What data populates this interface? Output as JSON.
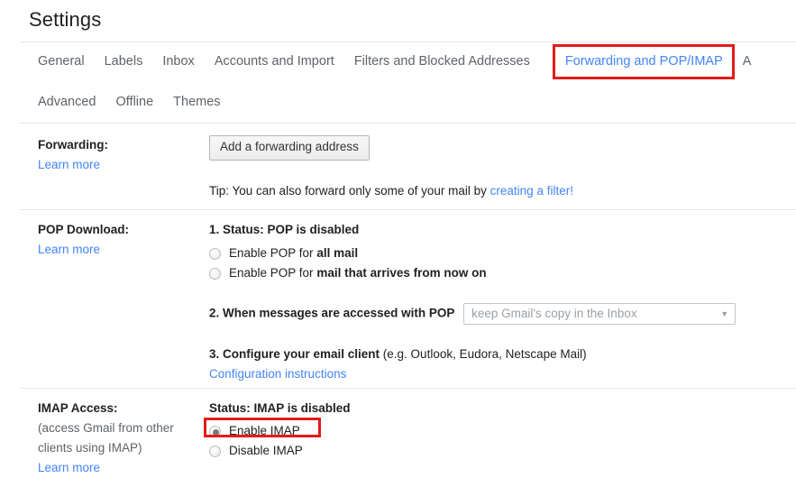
{
  "page": {
    "title": "Settings"
  },
  "tabs": {
    "row1": [
      {
        "label": "General",
        "active": false,
        "highlighted": false
      },
      {
        "label": "Labels",
        "active": false,
        "highlighted": false
      },
      {
        "label": "Inbox",
        "active": false,
        "highlighted": false
      },
      {
        "label": "Accounts and Import",
        "active": false,
        "highlighted": false
      },
      {
        "label": "Filters and Blocked Addresses",
        "active": false,
        "highlighted": false
      },
      {
        "label": "Forwarding and POP/IMAP",
        "active": true,
        "highlighted": true
      },
      {
        "label": "A",
        "active": false,
        "highlighted": false
      }
    ],
    "row2": [
      {
        "label": "Advanced",
        "active": false,
        "highlighted": false
      },
      {
        "label": "Offline",
        "active": false,
        "highlighted": false
      },
      {
        "label": "Themes",
        "active": false,
        "highlighted": false
      }
    ]
  },
  "forwarding": {
    "label": "Forwarding:",
    "learn_more": "Learn more",
    "add_button": "Add a forwarding address",
    "tip_prefix": "Tip: You can also forward only some of your mail by ",
    "tip_link": "creating a filter!"
  },
  "pop": {
    "label": "POP Download:",
    "learn_more": "Learn more",
    "status": "1. Status: POP is disabled",
    "option_all_prefix": "Enable POP for ",
    "option_all_strong": "all mail",
    "option_now_prefix": "Enable POP for ",
    "option_now_strong": "mail that arrives from now on",
    "step2_label": "2. When messages are accessed with POP",
    "step2_select_value": "keep Gmail's copy in the Inbox",
    "step2_select_caret": "▼",
    "step3_strong": "3. Configure your email client",
    "step3_rest": " (e.g. Outlook, Eudora, Netscape Mail)",
    "step3_link": "Configuration instructions"
  },
  "imap": {
    "label": "IMAP Access:",
    "note_line1": "(access Gmail from other",
    "note_line2": "clients using IMAP)",
    "learn_more": "Learn more",
    "status": "Status: IMAP is disabled",
    "enable_label": "Enable IMAP",
    "disable_label": "Disable IMAP",
    "enable_selected": true,
    "disable_selected": false
  },
  "colors": {
    "accent_link": "#4285f4",
    "highlight_box": "#e31b1b",
    "text_primary": "#222222",
    "text_muted": "#5f6368",
    "divider": "#e8e8e8"
  }
}
